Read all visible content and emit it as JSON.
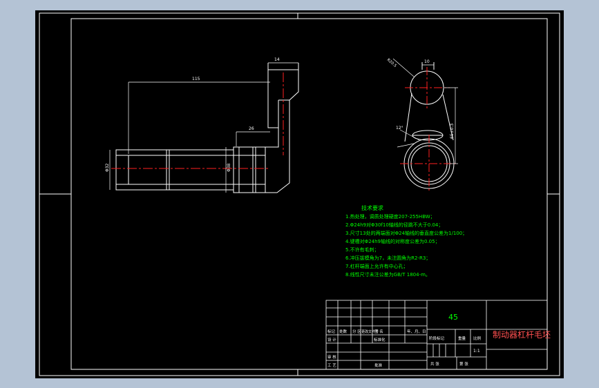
{
  "colors": {
    "background": "#b4c3d5",
    "sheet": "#000000",
    "line": "#ffffff",
    "centerline": "#ff2020",
    "requirements_text": "#00ff00",
    "dimension": "#ffffff"
  },
  "drawing": {
    "dims": {
      "top_width": "14",
      "length": "115",
      "short": "26",
      "dia_left": "Φ32",
      "dia_right": "Φ38",
      "right_top": "10",
      "center_distance": "65±0.3",
      "radius": "R20.5",
      "angle": "12°"
    }
  },
  "requirements": {
    "title": "技术要求",
    "items": [
      "1.热处理，调质处理硬度207-255HBW；",
      "2.Φ24h9对Φ30f10轴线的径跳不大于0.04；",
      "3.尺寸13处的两端面对Φ24轴线的垂直度公差为1/100；",
      "4.键槽对Φ24h9轴线的对称度公差为0.05；",
      "5.不许有毛刺；",
      "6.冲压拔模角为7，未注圆角为R2-R3；",
      "7.杠杆端面上允许有中心孔；",
      "8.线性尺寸未注公差为GB/T 1804-m。"
    ]
  },
  "title_block": {
    "material": "45",
    "drawing_name": "制动器杠杆毛坯",
    "labels": {
      "mark": "标记",
      "count": "处数",
      "zone": "分 区",
      "change_doc": "更改文件号",
      "signature": "签 名",
      "date": "年、月、日",
      "design": "设 计",
      "standardize": "标准化",
      "stage_mark": "阶段标记",
      "weight": "重量",
      "scale": "比例",
      "review": "审 核",
      "process": "工 艺",
      "approve": "批准",
      "sheets_total": "共    张",
      "sheet_no": "第    张"
    },
    "scale_value": "1:1"
  }
}
